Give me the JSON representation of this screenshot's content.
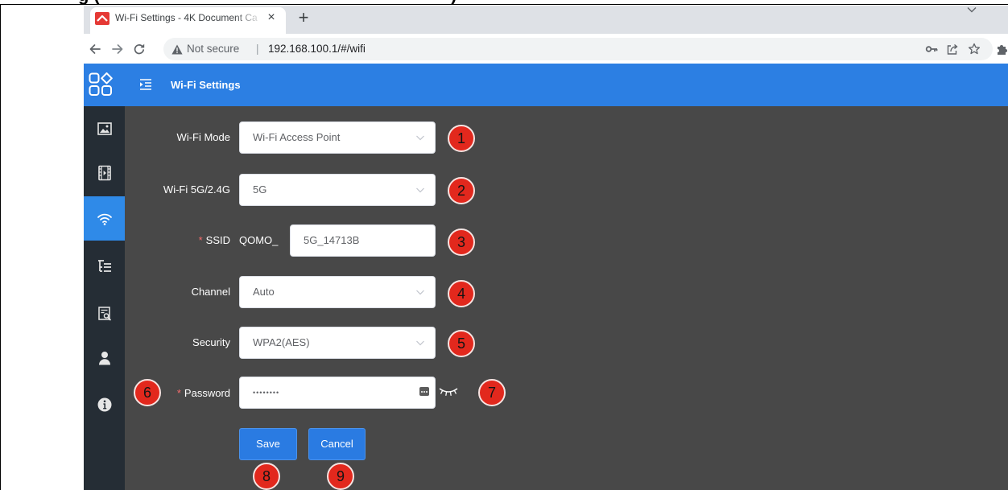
{
  "document": {
    "heading_fragment_left": "g (",
    "heading_fragment_right": ")"
  },
  "browser": {
    "tab": {
      "favicon_icon": "app-favicon-icon",
      "title": "Wi-Fi Settings - 4K Document Ca",
      "close_label": "×"
    },
    "new_tab_label": "+",
    "tab_search_icon": "chevron-down-icon",
    "nav": {
      "back_icon": "arrow-left-icon",
      "forward_icon": "arrow-right-icon",
      "reload_icon": "reload-icon"
    },
    "omnibox": {
      "security_icon": "warning-triangle-icon",
      "security_label": "Not secure",
      "separator": "|",
      "url": "192.168.100.1/#/wifi",
      "action_icons": [
        "key-icon",
        "share-icon",
        "star-icon"
      ]
    },
    "extensions_icon": "puzzle-icon"
  },
  "app": {
    "header": {
      "logo_icon": "apps-grid-icon",
      "menu_icon": "menu-fold-icon",
      "title": "Wi-Fi Settings"
    },
    "sidebar": {
      "items": [
        {
          "icon": "image-icon",
          "active": false
        },
        {
          "icon": "film-icon",
          "active": false
        },
        {
          "icon": "wifi-icon",
          "active": true
        },
        {
          "icon": "tree-list-icon",
          "active": false
        },
        {
          "icon": "report-search-icon",
          "active": false
        },
        {
          "icon": "user-icon",
          "active": false
        },
        {
          "icon": "info-icon",
          "active": false
        }
      ]
    },
    "form": {
      "wifi_mode": {
        "label": "Wi-Fi Mode",
        "value": "Wi-Fi Access Point"
      },
      "band": {
        "label": "Wi-Fi 5G/2.4G",
        "value": "5G"
      },
      "ssid": {
        "required_mark": "*",
        "label": "SSID",
        "prefix": "QOMO_",
        "value": "5G_14713B"
      },
      "channel": {
        "label": "Channel",
        "value": "Auto"
      },
      "security": {
        "label": "Security",
        "value": "WPA2(AES)"
      },
      "password": {
        "required_mark": "*",
        "label": "Password",
        "masked_value": "••••••••",
        "keyboard_icon": "password-keyboard-icon",
        "reveal_icon": "eye-closed-icon"
      },
      "save_label": "Save",
      "cancel_label": "Cancel"
    }
  },
  "callouts": [
    "1",
    "2",
    "3",
    "4",
    "5",
    "6",
    "7",
    "8",
    "9"
  ],
  "colors": {
    "header_blue": "#2c7fe3",
    "sidebar_bg": "#252d35",
    "content_bg": "#484848",
    "active_blue": "#2f8ae8",
    "callout_red": "#e2281d",
    "button_blue": "#2a7be2",
    "tabstrip_gray": "#dee1e6",
    "omnibox_gray": "#f1f3f4"
  }
}
